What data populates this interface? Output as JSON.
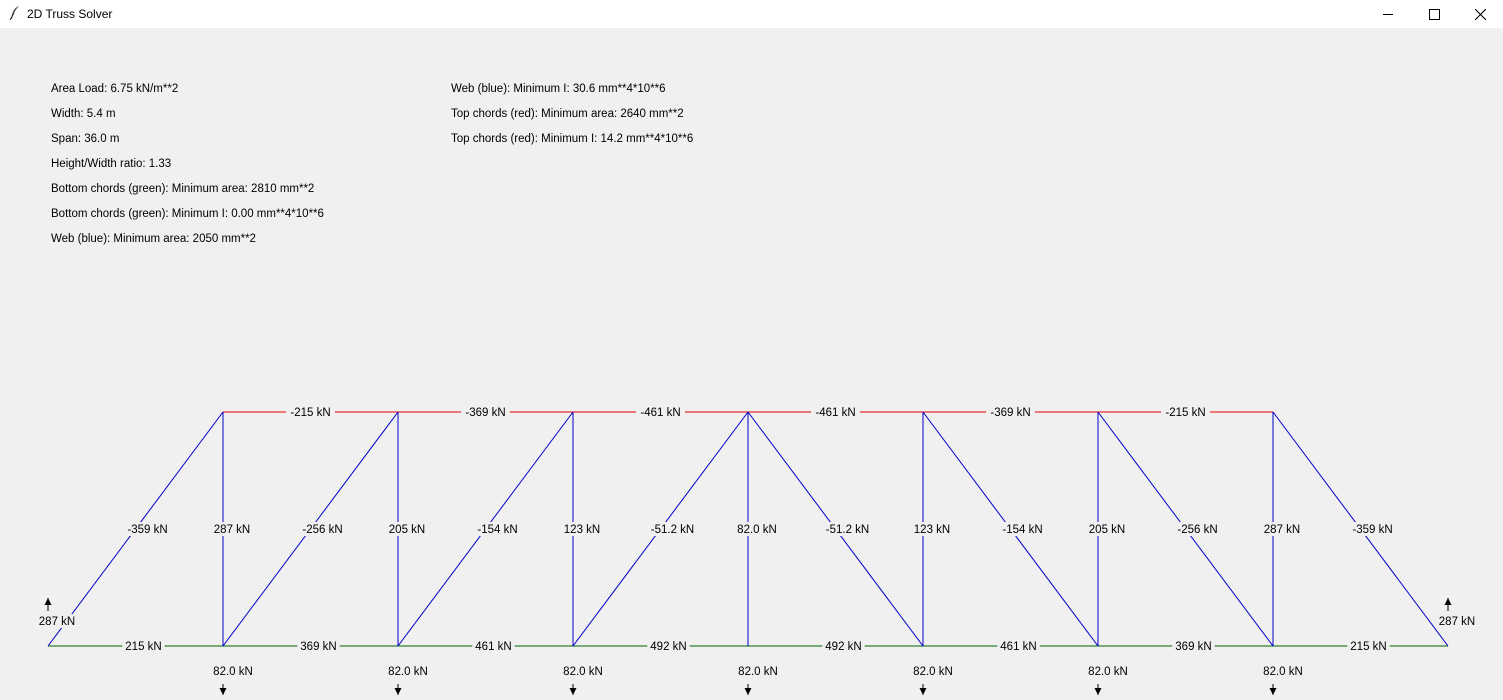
{
  "window": {
    "title": "2D Truss Solver",
    "icon": "feather-icon",
    "controls": [
      "minimize-icon",
      "maximize-icon",
      "close-icon"
    ]
  },
  "info_left": [
    "Area Load: 6.75 kN/m**2",
    "Width: 5.4 m",
    "Span: 36.0 m",
    "Height/Width ratio: 1.33",
    "Bottom chords (green): Minimum area: 2810 mm**2",
    "Bottom chords (green): Minimum I: 0.00 mm**4*10**6",
    "Web (blue): Minimum area: 2050 mm**2"
  ],
  "info_right": [
    "Web (blue): Minimum I: 30.6 mm**4*10**6",
    "Top chords (red): Minimum area: 2640 mm**2",
    "Top chords (red): Minimum I: 14.2 mm**4*10**6"
  ],
  "colors": {
    "top_chord": "#e00000",
    "bottom_chord": "#006400",
    "web": "#0000cc"
  },
  "truss": {
    "top_chord_forces": [
      "-215 kN",
      "-369 kN",
      "-461 kN",
      "-461 kN",
      "-369 kN",
      "-215 kN"
    ],
    "diagonal_forces": [
      "-359 kN",
      "-256 kN",
      "-154 kN",
      "-51.2 kN",
      "-51.2 kN",
      "-154 kN",
      "-256 kN",
      "-359 kN"
    ],
    "vertical_forces": [
      "287 kN",
      "205 kN",
      "123 kN",
      "82.0 kN",
      "123 kN",
      "205 kN",
      "287 kN"
    ],
    "bottom_chord_forces": [
      "215 kN",
      "369 kN",
      "461 kN",
      "492 kN",
      "492 kN",
      "461 kN",
      "369 kN",
      "215 kN"
    ],
    "node_loads": [
      "82.0 kN",
      "82.0 kN",
      "82.0 kN",
      "82.0 kN",
      "82.0 kN",
      "82.0 kN",
      "82.0 kN"
    ],
    "reactions": [
      "287 kN",
      "287 kN"
    ]
  }
}
